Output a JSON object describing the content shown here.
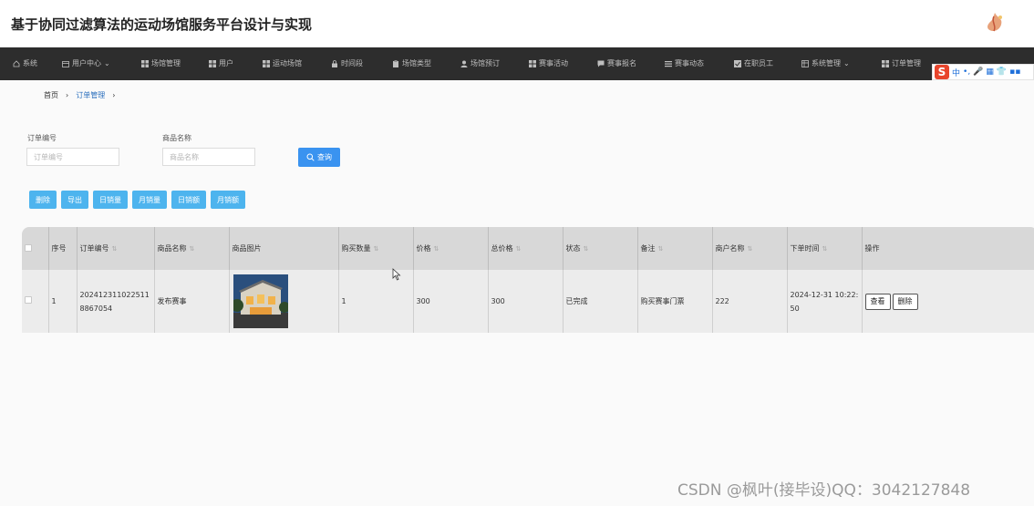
{
  "app": {
    "title": "基于协同过滤算法的运动场馆服务平台设计与实现"
  },
  "nav": {
    "items": [
      {
        "label": "系统",
        "icon": "home-icon"
      },
      {
        "label": "用户中心",
        "icon": "calendar-icon",
        "dropdown": true
      },
      {
        "label": "场馆管理",
        "icon": "grid-icon"
      },
      {
        "label": "用户",
        "icon": "grid-icon"
      },
      {
        "label": "运动场馆",
        "icon": "grid-icon"
      },
      {
        "label": "时间段",
        "icon": "lock-icon"
      },
      {
        "label": "场馆类型",
        "icon": "clipboard-icon"
      },
      {
        "label": "场馆预订",
        "icon": "user-icon"
      },
      {
        "label": "赛事活动",
        "icon": "grid-icon"
      },
      {
        "label": "赛事报名",
        "icon": "chat-icon"
      },
      {
        "label": "赛事动态",
        "icon": "list-icon"
      },
      {
        "label": "在职员工",
        "icon": "checkbox-icon"
      },
      {
        "label": "系统管理",
        "icon": "table-icon",
        "dropdown": true
      },
      {
        "label": "订单管理",
        "icon": "grid-icon"
      }
    ]
  },
  "ime": {
    "logo": "S",
    "mode": "中"
  },
  "breadcrumb": {
    "home": "首页",
    "current": "订单管理"
  },
  "search": {
    "order_no_label": "订单编号",
    "order_no_placeholder": "订单编号",
    "product_name_label": "商品名称",
    "product_name_placeholder": "商品名称",
    "button_label": "查询"
  },
  "actions": {
    "delete": "删除",
    "export": "导出",
    "daily_sales_qty": "日销量",
    "monthly_sales_qty": "月销量",
    "daily_sales_amount": "日销额",
    "monthly_sales_amount": "月销额"
  },
  "table": {
    "headers": {
      "index": "序号",
      "order_no": "订单编号",
      "product_name": "商品名称",
      "product_image": "商品图片",
      "quantity": "购买数量",
      "price": "价格",
      "total": "总价格",
      "status": "状态",
      "remark": "备注",
      "merchant": "商户名称",
      "order_time": "下单时间",
      "operation": "操作"
    },
    "rows": [
      {
        "index": "1",
        "order_no": "2024123110225118867054",
        "product_name": "发布赛事",
        "quantity": "1",
        "price": "300",
        "total": "300",
        "status": "已完成",
        "remark": "购买赛事门票",
        "merchant": "222",
        "order_time": "2024-12-31 10:22:50",
        "view": "查看",
        "delete": "删除"
      }
    ]
  },
  "watermark": "CSDN @枫叶(接毕设)QQ：3042127848",
  "colors": {
    "navbar": "#2d2d2d",
    "primary": "#3a93f0",
    "action": "#4db4ee"
  }
}
